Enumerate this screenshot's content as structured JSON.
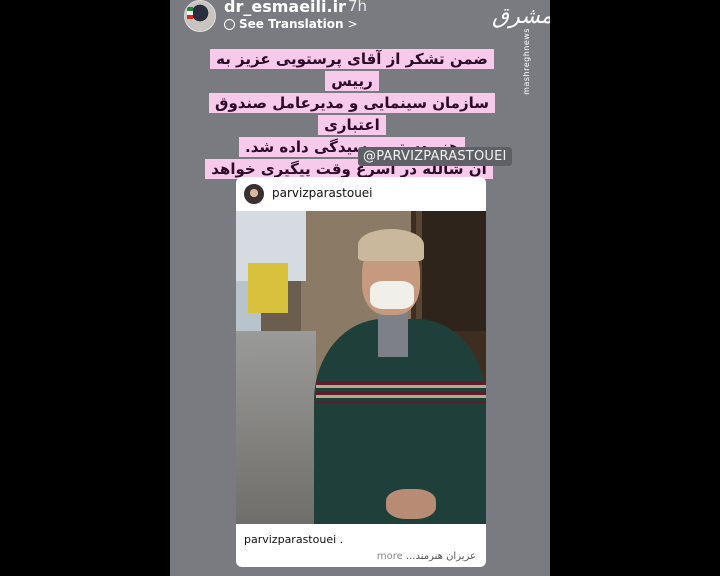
{
  "story": {
    "username": "dr_esmaeili.ir",
    "time": "7h",
    "translation_label": "See Translation",
    "translation_chevron": ">",
    "watermark": {
      "logo_text": "مشرق",
      "site": "mashreghnews"
    },
    "caption_lines": [
      "ضمن تشکر از آقای پرستویی عزیز به رییس",
      "سازمان سینمایی و مدیرعامل صندوق اعتباری",
      "هنر دستور رسیدگی داده شد.",
      "ان شالله در اسرع وقت پیگیری خواهد شد."
    ],
    "mention": "@PARVIZPARASTOUEI"
  },
  "post": {
    "username": "parvizparastouei",
    "caption_user": "parvizparastouei .",
    "caption_snippet": "عزیزان هنرمند...",
    "more_label": "more"
  },
  "colors": {
    "story_bg": "#7a7b80",
    "caption_bg": "#f7c9ea",
    "card_bg": "#ffffff"
  },
  "icons": {
    "translate": "globe-icon",
    "avatar": "profile-avatar-icon"
  }
}
